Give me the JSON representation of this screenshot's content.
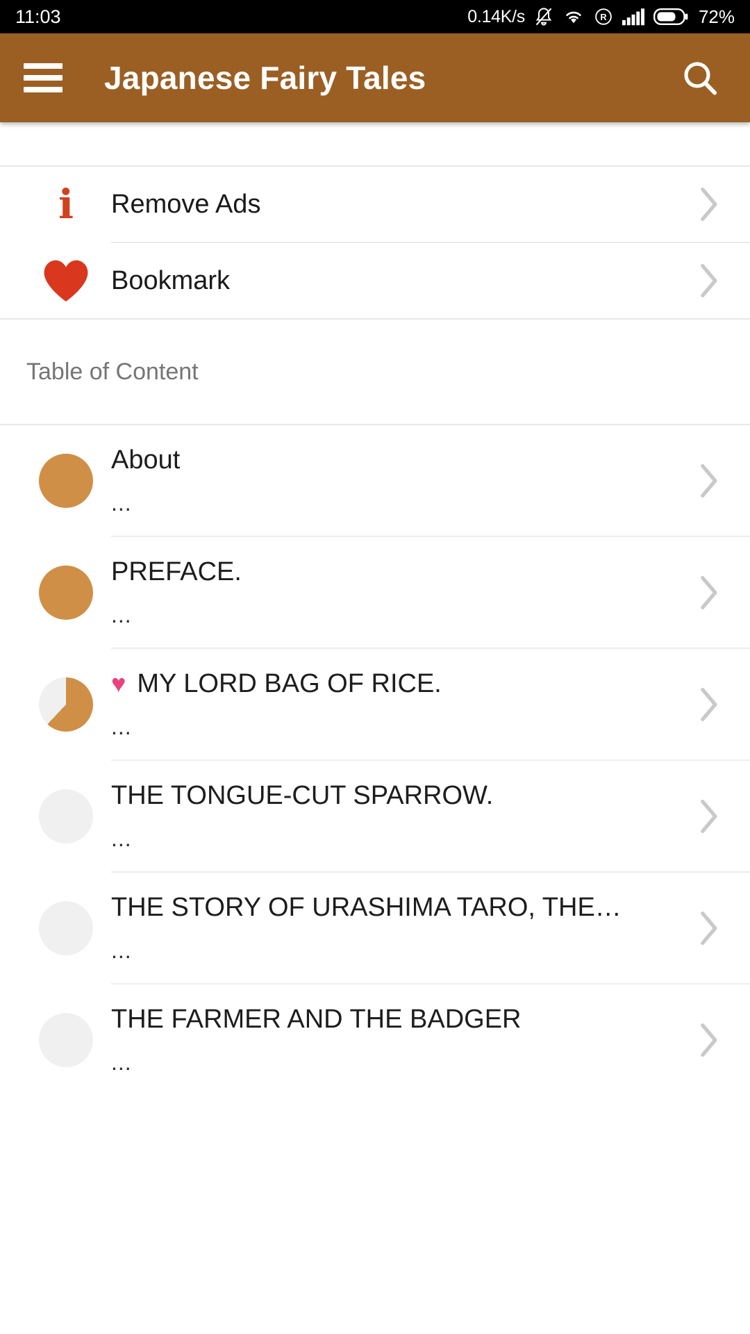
{
  "status_bar": {
    "time": "11:03",
    "network_speed": "0.14K/s",
    "icons": [
      "bell-muted-icon",
      "wifi-icon",
      "roaming-icon",
      "signal-bars-icon",
      "battery-icon"
    ],
    "battery_percent": "72%"
  },
  "app_bar": {
    "menu_icon": "hamburger-menu-icon",
    "title": "Japanese Fairy Tales",
    "search_icon": "search-icon",
    "background_color": "#9b5f24"
  },
  "actions": [
    {
      "icon": "info-icon",
      "icon_color": "#d1401f",
      "label": "Remove Ads",
      "chevron": "chevron-right-icon"
    },
    {
      "icon": "heart-icon",
      "icon_color": "#d9381e",
      "label": "Bookmark",
      "chevron": "chevron-right-icon"
    }
  ],
  "section": {
    "label": "Table of Content"
  },
  "toc": {
    "accent_color": "#cf8f47",
    "empty_color": "#f0f0f0",
    "bookmark_color": "#e8427f",
    "items": [
      {
        "title": "About",
        "subtitle": "...",
        "progress": 100,
        "bookmarked": false,
        "chevron": "chevron-right-icon"
      },
      {
        "title": "PREFACE.",
        "subtitle": "...",
        "progress": 100,
        "bookmarked": false,
        "chevron": "chevron-right-icon"
      },
      {
        "title": "MY LORD BAG OF RICE.",
        "subtitle": "...",
        "progress": 62,
        "bookmarked": true,
        "chevron": "chevron-right-icon"
      },
      {
        "title": "THE TONGUE-CUT SPARROW.",
        "subtitle": "...",
        "progress": 0,
        "bookmarked": false,
        "chevron": "chevron-right-icon"
      },
      {
        "title": "THE STORY OF URASHIMA TARO, THE…",
        "subtitle": "...",
        "progress": 0,
        "bookmarked": false,
        "chevron": "chevron-right-icon"
      },
      {
        "title": "THE FARMER AND THE BADGER",
        "subtitle": "...",
        "progress": 0,
        "bookmarked": false,
        "chevron": "chevron-right-icon"
      }
    ]
  }
}
